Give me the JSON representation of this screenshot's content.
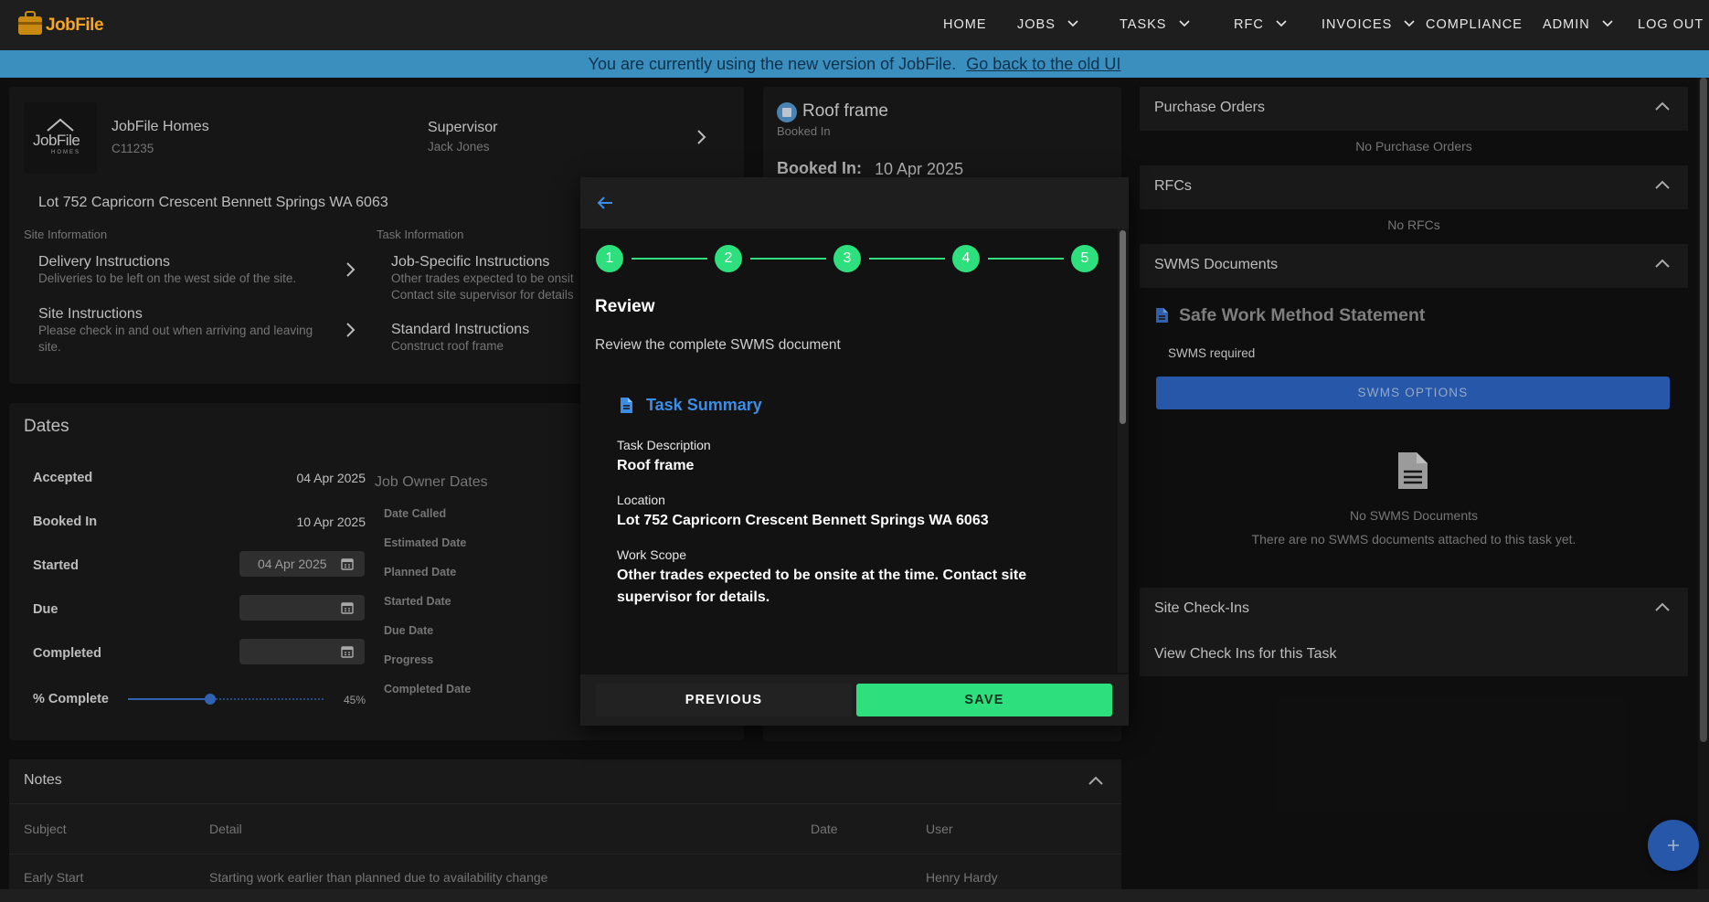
{
  "app": {
    "logo_text": "JobFile"
  },
  "nav": {
    "home": "HOME",
    "jobs": "JOBS",
    "tasks": "TASKS",
    "rfc": "RFC",
    "invoices": "INVOICES",
    "compliance": "COMPLIANCE",
    "admin": "ADMIN",
    "logout": "LOG OUT"
  },
  "banner": {
    "text": "You are currently using the new version of JobFile.",
    "link": "Go back to the old UI"
  },
  "job": {
    "builder_logo": "JobFile",
    "builder_logo_sub": "HOMES",
    "builder_name": "JobFile Homes",
    "builder_code": "C11235",
    "supervisor_label": "Supervisor",
    "supervisor_name": "Jack Jones",
    "address": "Lot 752 Capricorn Crescent Bennett Springs WA 6063",
    "site_info_heading": "Site Information",
    "task_info_heading": "Task Information",
    "delivery_title": "Delivery Instructions",
    "delivery_text": "Deliveries to be left on the west side of the site.",
    "site_instr_title": "Site Instructions",
    "site_instr_text_1": "Please check in and out when arriving and leaving",
    "site_instr_text_2": "site.",
    "job_specific_title": "Job-Specific Instructions",
    "job_specific_text_1": "Other trades expected to be onsit",
    "job_specific_text_2": "Contact site supervisor for details",
    "standard_title": "Standard Instructions",
    "standard_text": "Construct roof frame"
  },
  "task_card": {
    "title": "Roof frame",
    "status": "Booked In",
    "booked_label": "Booked In:",
    "booked_value": "10 Apr 2025"
  },
  "dates": {
    "heading": "Dates",
    "accepted_label": "Accepted",
    "accepted_value": "04 Apr 2025",
    "booked_label": "Booked In",
    "booked_value": "10 Apr 2025",
    "started_label": "Started",
    "started_value": "04 Apr 2025",
    "due_label": "Due",
    "due_value": "",
    "completed_label": "Completed",
    "completed_value": "",
    "pct_label": "% Complete",
    "pct_value": "45%",
    "pct_fraction": 0.45,
    "owner_heading": "Job Owner Dates",
    "owner_fields": [
      "Date Called",
      "Estimated Date",
      "Planned Date",
      "Started Date",
      "Due Date",
      "Progress",
      "Completed Date"
    ]
  },
  "modal": {
    "steps": [
      "1",
      "2",
      "3",
      "4",
      "5"
    ],
    "heading": "Review",
    "subheading": "Review the complete SWMS document",
    "section_title": "Task Summary",
    "task_desc_label": "Task Description",
    "task_desc_value": "Roof frame",
    "location_label": "Location",
    "location_value": "Lot 752 Capricorn Crescent Bennett Springs WA 6063",
    "scope_label": "Work Scope",
    "scope_value": "Other trades expected to be onsite at the time. Contact site supervisor for details.",
    "prev_button": "PREVIOUS",
    "save_button": "SAVE",
    "accent_color": "#2ee07d"
  },
  "right": {
    "po_title": "Purchase Orders",
    "po_empty": "No Purchase Orders",
    "rfc_title": "RFCs",
    "rfc_empty": "No RFCs",
    "swms_title": "SWMS Documents",
    "swms_heading": "Safe Work Method Statement",
    "swms_required": "SWMS required",
    "swms_button": "SWMS OPTIONS",
    "swms_empty_title": "No SWMS Documents",
    "swms_empty_text": "There are no SWMS documents attached to this task yet.",
    "checkins_title": "Site Check-Ins",
    "checkins_link": "View Check Ins for this Task"
  },
  "notes": {
    "title": "Notes",
    "columns": [
      "Subject",
      "Detail",
      "Date",
      "User"
    ],
    "rows": [
      {
        "subject": "Early Start",
        "detail": "Starting work earlier than planned due to availability change",
        "date": "",
        "user": "Henry Hardy"
      }
    ]
  }
}
